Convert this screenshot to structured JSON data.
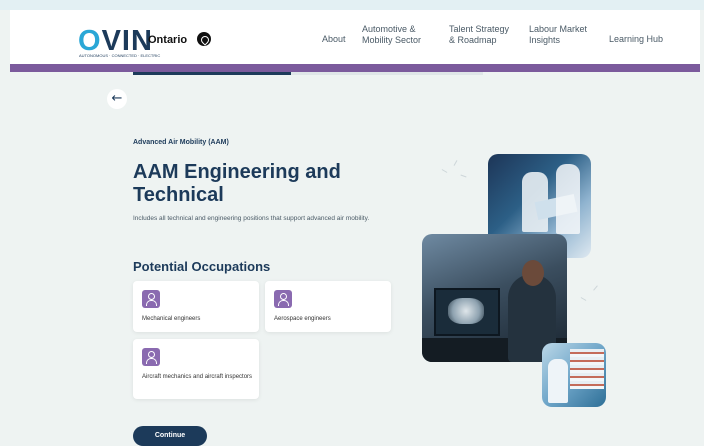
{
  "header": {
    "logo_text": "OVIN",
    "logo_tagline": "AUTONOMOUS · CONNECTED · ELECTRIC",
    "partner": "Ontario",
    "nav": [
      {
        "label": "About"
      },
      {
        "label": "Automotive & Mobility Sector"
      },
      {
        "label": "Talent Strategy & Roadmap"
      },
      {
        "label": "Labour Market Insights"
      },
      {
        "label": "Learning Hub"
      }
    ]
  },
  "progress": {
    "fraction": 0.45
  },
  "content": {
    "eyebrow": "Advanced Air Mobility (AAM)",
    "title": "AAM Engineering and Technical",
    "description": "Includes all technical and engineering positions that support advanced air mobility.",
    "occupations_heading": "Potential Occupations",
    "occupations": [
      {
        "label": "Mechanical engineers",
        "icon": "person-icon"
      },
      {
        "label": "Aerospace engineers",
        "icon": "person-icon"
      },
      {
        "label": "Aircraft mechanics and aircraft inspectors",
        "icon": "person-icon"
      }
    ],
    "continue_label": "Continue"
  },
  "colors": {
    "accent_purple": "#7b5a9c",
    "navy": "#1c3a5a",
    "background": "#eef3f2"
  }
}
